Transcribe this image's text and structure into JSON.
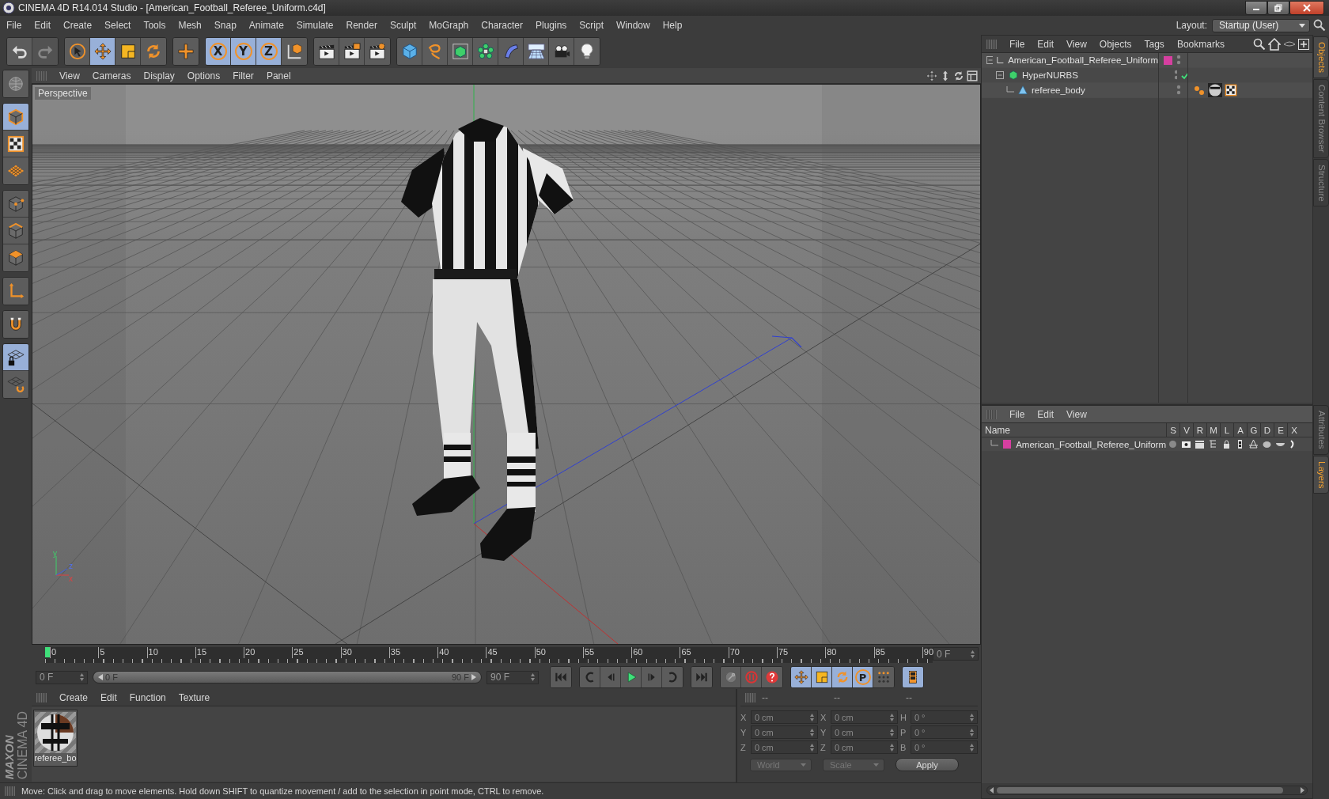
{
  "window": {
    "title": "CINEMA 4D R14.014 Studio - [American_Football_Referee_Uniform.c4d]"
  },
  "menu": [
    "File",
    "Edit",
    "Create",
    "Select",
    "Tools",
    "Mesh",
    "Snap",
    "Animate",
    "Simulate",
    "Render",
    "Sculpt",
    "MoGraph",
    "Character",
    "Plugins",
    "Script",
    "Window",
    "Help"
  ],
  "layout": {
    "label": "Layout:",
    "value": "Startup (User)"
  },
  "toolbar": [
    [
      {
        "kind": "undo",
        "selected": false,
        "disabled": false
      },
      {
        "kind": "redo",
        "selected": false,
        "disabled": true
      }
    ],
    [
      {
        "kind": "select",
        "selected": false,
        "disabled": false
      },
      {
        "kind": "move",
        "selected": true,
        "disabled": false
      },
      {
        "kind": "scale",
        "selected": false,
        "disabled": false
      },
      {
        "kind": "rotate",
        "selected": false,
        "disabled": false
      }
    ],
    [
      {
        "kind": "plus",
        "selected": false,
        "disabled": false
      }
    ],
    [
      {
        "kind": "axis",
        "label": "X",
        "selected": true,
        "disabled": false
      },
      {
        "kind": "axis",
        "label": "Y",
        "selected": true,
        "disabled": false
      },
      {
        "kind": "axis",
        "label": "Z",
        "selected": true,
        "disabled": false
      },
      {
        "kind": "coord",
        "selected": false,
        "disabled": false
      }
    ],
    [
      {
        "kind": "clap",
        "selected": false,
        "disabled": false
      },
      {
        "kind": "clap2",
        "selected": false,
        "disabled": false
      },
      {
        "kind": "clap3",
        "selected": false,
        "disabled": false
      }
    ],
    [
      {
        "kind": "cube",
        "selected": false,
        "disabled": false
      },
      {
        "kind": "spline",
        "selected": false,
        "disabled": false
      },
      {
        "kind": "nurbs",
        "selected": false,
        "disabled": false
      },
      {
        "kind": "cloner",
        "selected": false,
        "disabled": false
      },
      {
        "kind": "deformer",
        "selected": false,
        "disabled": false
      },
      {
        "kind": "floor",
        "selected": false,
        "disabled": false
      },
      {
        "kind": "camera",
        "selected": false,
        "disabled": false
      },
      {
        "kind": "light",
        "selected": false,
        "disabled": false
      }
    ]
  ],
  "tools": [
    [
      {
        "kind": "globe",
        "selected": false
      }
    ],
    [
      {
        "kind": "model",
        "selected": true
      },
      {
        "kind": "texture",
        "selected": false
      },
      {
        "kind": "workplane",
        "selected": false
      }
    ],
    [
      {
        "kind": "points",
        "selected": false
      },
      {
        "kind": "edges",
        "selected": false
      },
      {
        "kind": "polys",
        "selected": false
      }
    ],
    [
      {
        "kind": "axisTool",
        "selected": false
      }
    ],
    [
      {
        "kind": "snap",
        "selected": false
      }
    ],
    [
      {
        "kind": "lockgrid",
        "selected": true
      },
      {
        "kind": "gridrot",
        "selected": false
      }
    ]
  ],
  "brand": {
    "maker": "MAXON",
    "product": "CINEMA 4D"
  },
  "viewport": {
    "menu": [
      "View",
      "Cameras",
      "Display",
      "Options",
      "Filter",
      "Panel"
    ],
    "camera": "Perspective",
    "gizmo": [
      "y",
      "z",
      "x"
    ]
  },
  "timeline": {
    "frame_labels": [
      "0",
      "5",
      "10",
      "15",
      "20",
      "25",
      "30",
      "35",
      "40",
      "45",
      "50",
      "55",
      "60",
      "65",
      "70",
      "75",
      "80",
      "85",
      "90"
    ],
    "current_frame": "0 F",
    "range_start": "0 F",
    "slider_start": "0 F",
    "slider_end": "90 F",
    "level": 1,
    "range_end": "90 F"
  },
  "playback": [
    [
      {
        "kind": "first"
      }
    ],
    [
      {
        "kind": "prevkey"
      },
      {
        "kind": "prevframe"
      },
      {
        "kind": "play"
      },
      {
        "kind": "nextframe"
      },
      {
        "kind": "nextkey"
      }
    ],
    [
      {
        "kind": "last"
      }
    ],
    [
      {
        "kind": "key"
      },
      {
        "kind": "record"
      },
      {
        "kind": "help"
      }
    ],
    [
      {
        "kind": "move",
        "selected": true
      },
      {
        "kind": "scale",
        "selected": true
      },
      {
        "kind": "rotate",
        "selected": true
      },
      {
        "kind": "param",
        "label": "P",
        "selected": true
      },
      {
        "kind": "dots",
        "selected": false
      }
    ],
    [
      {
        "kind": "film",
        "selected": true
      }
    ]
  ],
  "materials": {
    "menu": [
      "Create",
      "Edit",
      "Function",
      "Texture"
    ],
    "items": [
      {
        "name": "referee_bo"
      }
    ]
  },
  "coordinates": {
    "headers": [
      "--",
      "--",
      "--"
    ],
    "rows": [
      {
        "label": "X",
        "value": "0 cm",
        "size_label": "X",
        "size_value": "0 cm",
        "rot_label": "H",
        "rot_value": "0 °"
      },
      {
        "label": "Y",
        "value": "0 cm",
        "size_label": "Y",
        "size_value": "0 cm",
        "rot_label": "P",
        "rot_value": "0 °"
      },
      {
        "label": "Z",
        "value": "0 cm",
        "size_label": "Z",
        "size_value": "0 cm",
        "rot_label": "B",
        "rot_value": "0 °"
      }
    ],
    "space": "World",
    "mode": "Scale",
    "apply": "Apply"
  },
  "status_bar": "Move: Click and drag to move elements. Hold down SHIFT to quantize movement / add to the selection in point mode, CTRL to remove.",
  "objects": {
    "menu": [
      "File",
      "Edit",
      "View",
      "Objects",
      "Tags",
      "Bookmarks"
    ],
    "tree": [
      {
        "name": "American_Football_Referee_Uniform",
        "kind": "null",
        "color": "#d63fa0",
        "children": [
          {
            "name": "HyperNURBS",
            "kind": "hypernurbs",
            "enabled": true,
            "children": [
              {
                "name": "referee_body",
                "kind": "polygon"
              }
            ]
          }
        ]
      }
    ]
  },
  "layers": {
    "menu": [
      "File",
      "Edit",
      "View"
    ],
    "columns": [
      "Name",
      "S",
      "V",
      "R",
      "M",
      "L",
      "A",
      "G",
      "D",
      "E",
      "X"
    ],
    "items": [
      {
        "name": "American_Football_Referee_Uniform",
        "color": "#d63fa0"
      }
    ]
  },
  "side_tabs": {
    "upper": [
      {
        "label": "Objects",
        "selected": true
      },
      {
        "label": "Content Browser",
        "selected": false
      },
      {
        "label": "Structure",
        "selected": false
      }
    ],
    "lower": [
      {
        "label": "Attributes",
        "selected": false
      },
      {
        "label": "Layers",
        "selected": true
      }
    ]
  }
}
